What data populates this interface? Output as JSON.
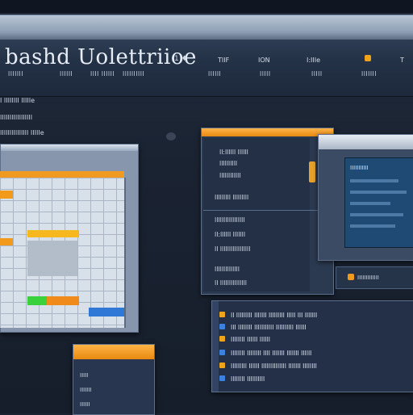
{
  "header": {
    "logo_text": "bashd Uolettriioe",
    "logo_mark": "1 ♦",
    "nav_top": [
      "TIIF",
      "ION",
      "I:IIIe",
      "T"
    ],
    "nav_sub": [
      "IIIIIII",
      "IIIIII",
      "IIII IIIIII",
      "IIIIIIIIII",
      "IIIIII",
      "IIIII",
      "IIIII",
      "IIIIIII"
    ]
  },
  "sidebar": {
    "lines": [
      "I IIIIIIII IIIIIe",
      "IIIIIIIIIIIIIIIII",
      "IIIIIIIIIIIIIII IIIIIe"
    ]
  },
  "dialog1": {
    "lines_top": [
      "II:IIIIII IIIIII",
      "IIIIIIIIII",
      "IIIIIIIIIIII",
      "IIIIIIIII IIIIIIIII"
    ],
    "lines_bottom": [
      "IIIIIIIIIIIIIIIII",
      "II:IIIIII IIIIIII",
      "II IIIIIIIIIIIIIIIII",
      "IIIIIIIIIIIIII",
      "II IIIIIIIIIIIIIII"
    ]
  },
  "dialog2": {
    "caption": "IIIIIIIIIII",
    "strip_label": "IIIIIIIIIIIII"
  },
  "list": {
    "rows": [
      "II IIIIIIIII IIIIIII IIIIIIIII IIIII III IIIIIII",
      "III IIIIIIII IIIIIIIIIII IIIIIIIIII IIIIII",
      "IIIIIIII IIIIII IIIIII",
      "IIIIIIII IIIIIIII IIII IIIIIII IIIIIII IIIIII",
      "IIIIIIIII IIIIII IIIIIIIIIIIIII IIIIIII IIIIIIII",
      "IIIIIIII IIIIIIIIII"
    ]
  },
  "bottom_panel": {
    "lines": [
      "IIIII",
      "IIIIIII",
      "IIIIII"
    ]
  },
  "colors": {
    "accent_orange": "#f29a1c",
    "bar_green": "#3ad13a",
    "bar_blue": "#2f78d6"
  },
  "icons": {
    "logo": "logo-mark-icon",
    "nav": "orange-square-icon",
    "list": "bullet-icon"
  }
}
